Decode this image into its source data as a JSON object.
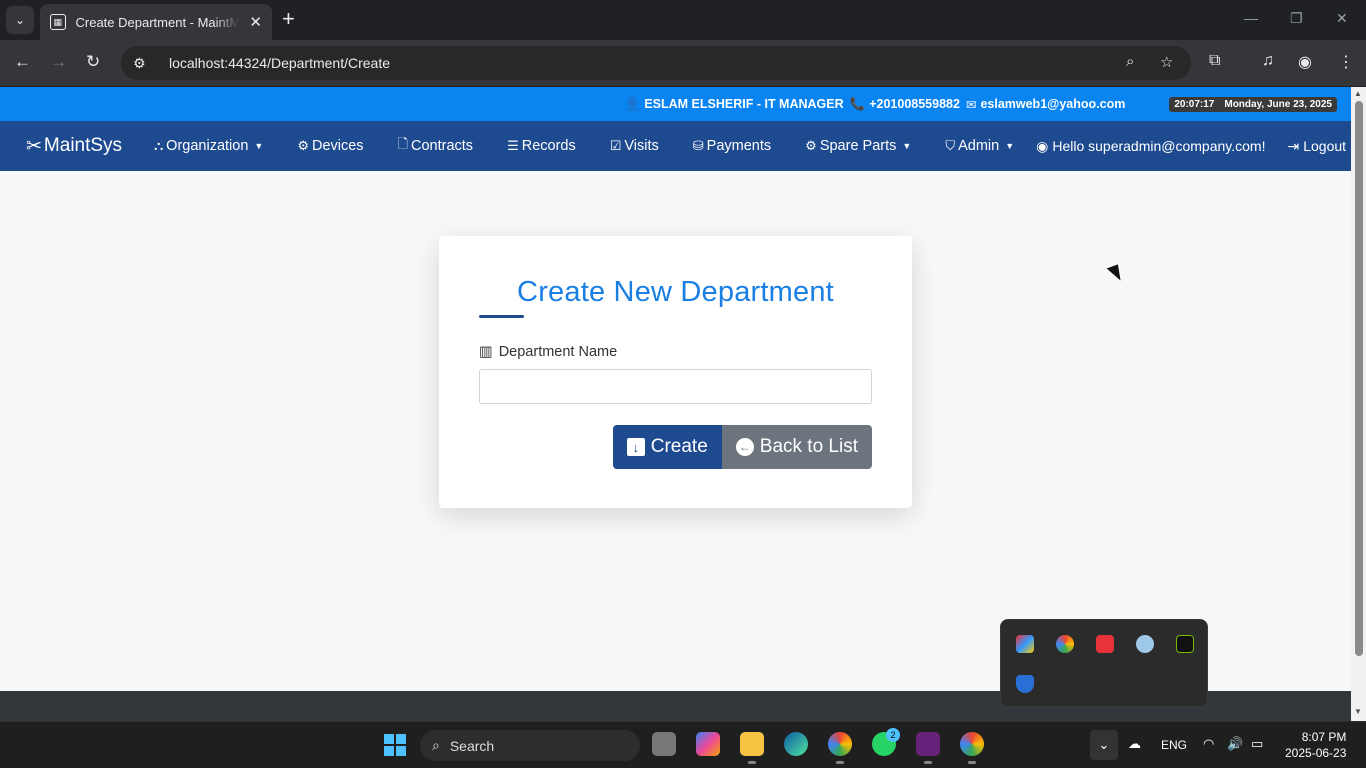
{
  "browser": {
    "tab_title": "Create Department - MaintMaster",
    "url": "localhost:44324/Department/Create"
  },
  "infobar": {
    "user": "ESLAM ELSHERIF - IT MANAGER",
    "phone": "+201008559882",
    "email": "eslamweb1@yahoo.com",
    "time": "20:07:17",
    "date": "Monday, June 23, 2025"
  },
  "navbar": {
    "brand": "MaintSys",
    "items": [
      {
        "label": "Organization",
        "dropdown": true,
        "icon": "sitemap-icon"
      },
      {
        "label": "Devices",
        "dropdown": false,
        "icon": "chip-icon"
      },
      {
        "label": "Contracts",
        "dropdown": false,
        "icon": "file-icon"
      },
      {
        "label": "Records",
        "dropdown": false,
        "icon": "list-icon"
      },
      {
        "label": "Visits",
        "dropdown": false,
        "icon": "calendar-check-icon"
      },
      {
        "label": "Payments",
        "dropdown": false,
        "icon": "coins-icon"
      },
      {
        "label": "Spare Parts",
        "dropdown": true,
        "icon": "gear-icon"
      },
      {
        "label": "Admin",
        "dropdown": true,
        "icon": "shield-icon"
      }
    ],
    "greeting": "Hello superadmin@company.com!",
    "logout": "Logout"
  },
  "form": {
    "title": "Create New Department",
    "field_label": "Department Name",
    "field_value": "",
    "create_label": "Create",
    "back_label": "Back to List"
  },
  "taskbar": {
    "search_label": "Search",
    "whatsapp_badge": "2",
    "lang": "ENG",
    "clock_time": "8:07 PM",
    "clock_date": "2025-06-23"
  }
}
